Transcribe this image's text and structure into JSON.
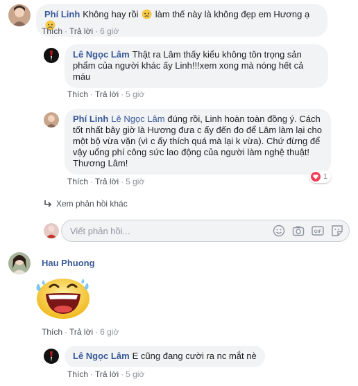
{
  "comments": [
    {
      "author": "Phí Linh",
      "text_part1": "Không hay rồi",
      "text_part2": "làm thế này là không đẹp em Hương ạ",
      "actions": {
        "like": "Thích",
        "reply": "Trả lời",
        "time": "6 giờ"
      }
    },
    {
      "author": "Lê Ngọc Lâm",
      "text": "Thật ra Lâm thấy kiểu không tôn trọng sản phẩm của người khác ấy Linh!!!xem xong mà nóng hết cả máu",
      "actions": {
        "like": "Thích",
        "reply": "Trả lời",
        "time": "5 giờ"
      }
    },
    {
      "author": "Phí Linh",
      "mention": "Lê Ngọc Lâm",
      "text": "đúng rồi, Linh hoàn toàn đồng ý. Cách tốt nhất bây giờ là Hương đưa c ấy đến đo để Lâm làm lại cho một bộ vừa vặn (vì c ấy thích quá mà lại k vừa). Chứ đừng để vậy uổng phí công sức lao động của người làm nghệ thuật! Thương Lâm!",
      "actions": {
        "like": "Thích",
        "reply": "Trả lời",
        "time": "5 giờ"
      },
      "reaction_count": "1"
    },
    {
      "author": "Hau Phuong",
      "actions": {
        "like": "Thích",
        "reply": "Trả lời",
        "time": "6 giờ"
      }
    },
    {
      "author": "Lê Ngọc Lâm",
      "text": "E cũng đang cười ra nc mắt nè",
      "actions": {
        "like": "Thích",
        "reply": "Trả lời",
        "time": "5 giờ"
      }
    }
  ],
  "more_replies": "Xem phản hồi khác",
  "reply_box": {
    "placeholder": "Viết phản hồi..."
  },
  "tools": [
    "emoji-icon",
    "camera-icon",
    "gif-icon",
    "sticker-icon"
  ],
  "colors": {
    "link": "#385898",
    "bubble": "#f2f3f5",
    "meta": "#90949c",
    "heart": "#f33e58"
  }
}
